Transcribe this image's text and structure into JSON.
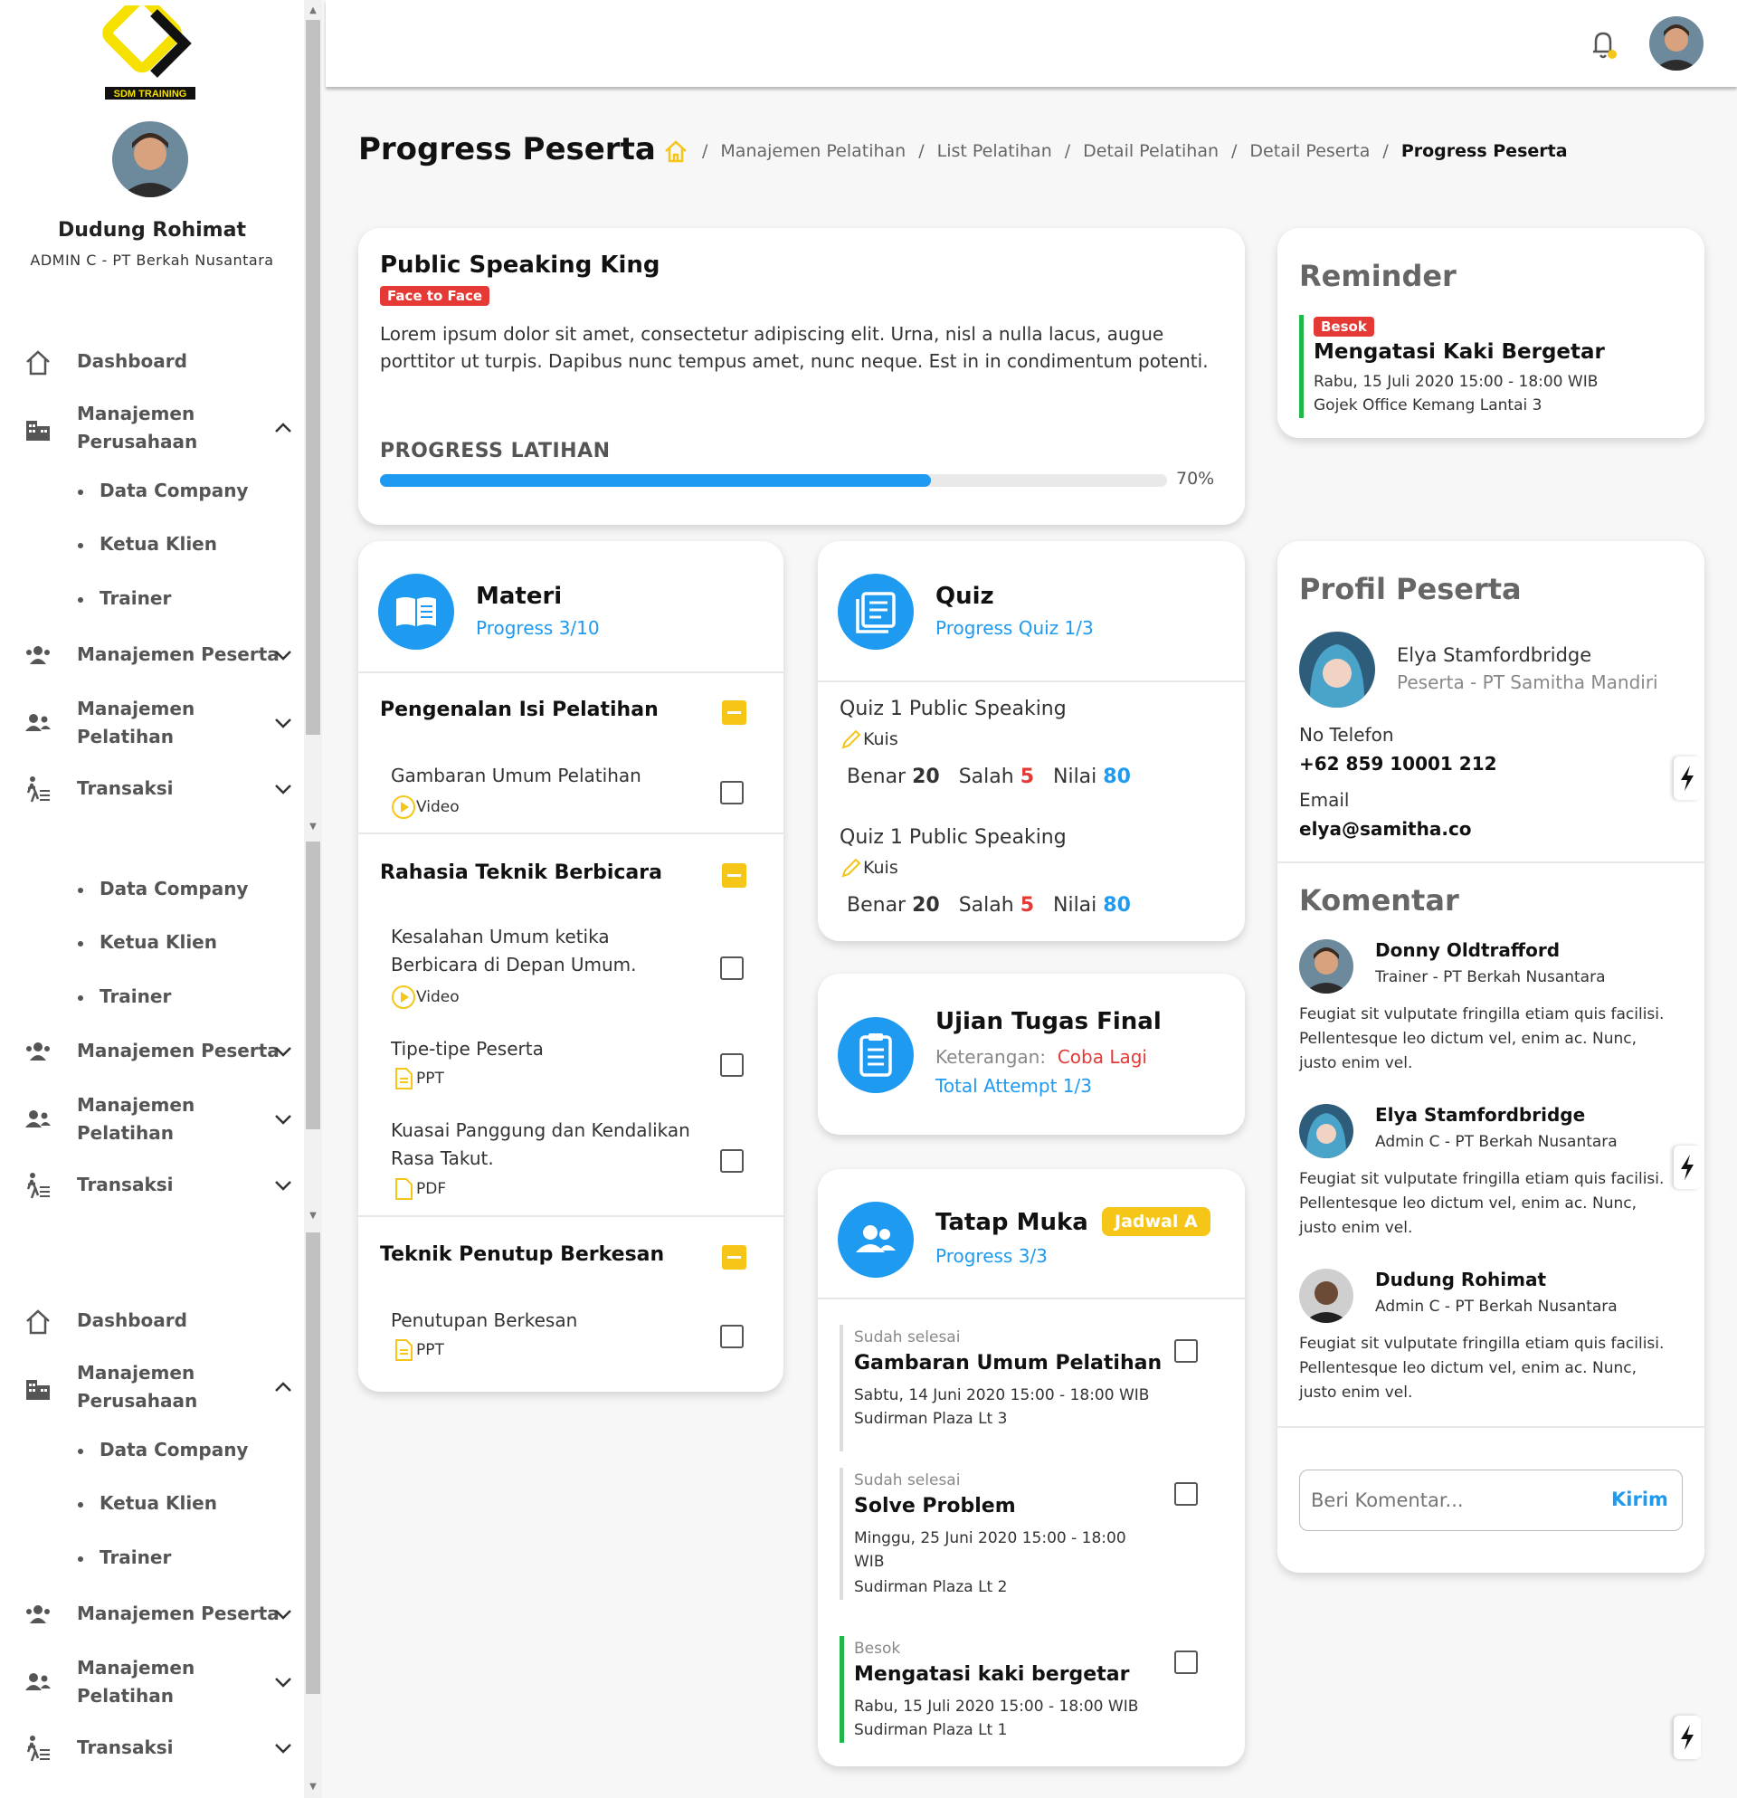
{
  "app": {
    "logo_text": "SDM TRAINING"
  },
  "user": {
    "name": "Dudung Rohimat",
    "role": "ADMIN C - PT Berkah Nusantara"
  },
  "nav": {
    "dashboard": "Dashboard",
    "perusahaan": "Manajemen Perusahaan",
    "perusahaan_l1": "Manajemen",
    "perusahaan_l2": "Perusahaan",
    "sub": [
      "Data Company",
      "Ketua Klien",
      "Trainer"
    ],
    "peserta": "Manajemen Peserta",
    "pelatihan_l1": "Manajemen",
    "pelatihan_l2": "Pelatihan",
    "transaksi": "Transaksi"
  },
  "page": {
    "title": "Progress Peserta",
    "breadcrumb": [
      "Manajemen Pelatihan",
      "List Pelatihan",
      "Detail Pelatihan",
      "Detail Peserta",
      "Progress Peserta"
    ]
  },
  "training": {
    "title": "Public Speaking King",
    "tag": "Face to Face",
    "description": "Lorem ipsum dolor sit amet, consectetur adipiscing elit. Urna, nisl a nulla lacus, augue porttitor ut turpis. Dapibus nunc tempus amet, nunc neque. Est in in condimentum potenti.",
    "progress_label": "PROGRESS LATIHAN",
    "progress_value": 0.7,
    "progress_text": "70%"
  },
  "materi": {
    "title": "Materi",
    "progress": "Progress 3/10",
    "sections": [
      {
        "title": "Pengenalan Isi Pelatihan",
        "items": [
          {
            "title": "Gambaran Umum Pelatihan",
            "type": "Video"
          }
        ]
      },
      {
        "title": "Rahasia Teknik Berbicara",
        "items": [
          {
            "title_l1": "Kesalahan Umum ketika",
            "title_l2": "Berbicara di Depan Umum.",
            "type": "Video"
          },
          {
            "title": "Tipe-tipe Peserta",
            "type": "PPT"
          },
          {
            "title_l1": "Kuasai Panggung dan Kendalikan",
            "title_l2": "Rasa Takut.",
            "type": "PDF"
          }
        ]
      },
      {
        "title": "Teknik Penutup Berkesan",
        "items": [
          {
            "title": "Penutupan Berkesan",
            "type": "PPT"
          }
        ]
      }
    ]
  },
  "quiz": {
    "title": "Quiz",
    "progress": "Progress Quiz 1/3",
    "items": [
      {
        "title": "Quiz 1 Public Speaking",
        "type": "Kuis",
        "benar_label": "Benar",
        "benar": "20",
        "salah_label": "Salah",
        "salah": "5",
        "nilai_label": "Nilai",
        "nilai": "80"
      },
      {
        "title": "Quiz 1 Public Speaking",
        "type": "Kuis",
        "benar_label": "Benar",
        "benar": "20",
        "salah_label": "Salah",
        "salah": "5",
        "nilai_label": "Nilai",
        "nilai": "80"
      }
    ]
  },
  "ujian": {
    "title": "Ujian Tugas Final",
    "keterangan_label": "Keterangan:",
    "keterangan_value": "Coba Lagi",
    "attempt": "Total Attempt 1/3"
  },
  "tatap_muka": {
    "title": "Tatap Muka",
    "badge": "Jadwal A",
    "progress": "Progress 3/3",
    "items": [
      {
        "status": "Sudah selesai",
        "title": "Gambaran Umum Pelatihan",
        "time": "Sabtu, 14 Juni 2020 15:00 - 18:00 WIB",
        "place": "Sudirman Plaza Lt 3"
      },
      {
        "status": "Sudah selesai",
        "title": "Solve Problem",
        "time_l1": "Minggu, 25 Juni 2020 15:00 - 18:00",
        "time_l2": "WIB",
        "place": "Sudirman Plaza Lt 2"
      },
      {
        "status": "Besok",
        "title": "Mengatasi kaki bergetar",
        "time": "Rabu, 15 Juli 2020 15:00 - 18:00 WIB",
        "place": "Sudirman Plaza Lt 1"
      }
    ]
  },
  "reminder": {
    "title": "Reminder",
    "tag": "Besok",
    "event": "Mengatasi Kaki Bergetar",
    "time": "Rabu, 15 Juli 2020 15:00 - 18:00 WIB",
    "place": "Gojek Office Kemang Lantai 3"
  },
  "profil": {
    "title": "Profil Peserta",
    "name": "Elya Stamfordbridge",
    "role": "Peserta - PT Samitha Mandiri",
    "phone_label": "No Telefon",
    "phone": "+62 859 10001 212",
    "email_label": "Email",
    "email": "elya@samitha.co"
  },
  "komentar": {
    "title": "Komentar",
    "items": [
      {
        "name": "Donny Oldtrafford",
        "role": "Trainer - PT Berkah Nusantara",
        "text_l1": "Feugiat sit vulputate fringilla etiam quis facilisi.",
        "text_l2": "Pellentesque leo dictum vel, enim ac. Nunc,",
        "text_l3": "justo enim vel."
      },
      {
        "name": "Elya Stamfordbridge",
        "role": "Admin C - PT Berkah Nusantara",
        "text_l1": "Feugiat sit vulputate fringilla etiam quis facilisi.",
        "text_l2": "Pellentesque leo dictum vel, enim ac. Nunc,",
        "text_l3": "justo enim vel."
      },
      {
        "name": "Dudung Rohimat",
        "role": "Admin C - PT Berkah Nusantara",
        "text_l1": "Feugiat sit vulputate fringilla etiam quis facilisi.",
        "text_l2": "Pellentesque leo dictum vel, enim ac. Nunc,",
        "text_l3": "justo enim vel."
      }
    ],
    "placeholder": "Beri Komentar...",
    "send": "Kirim"
  },
  "colors": {
    "accent": "#1e9af0",
    "danger": "#e53935",
    "warning": "#f5c518",
    "success": "#21b84a"
  }
}
